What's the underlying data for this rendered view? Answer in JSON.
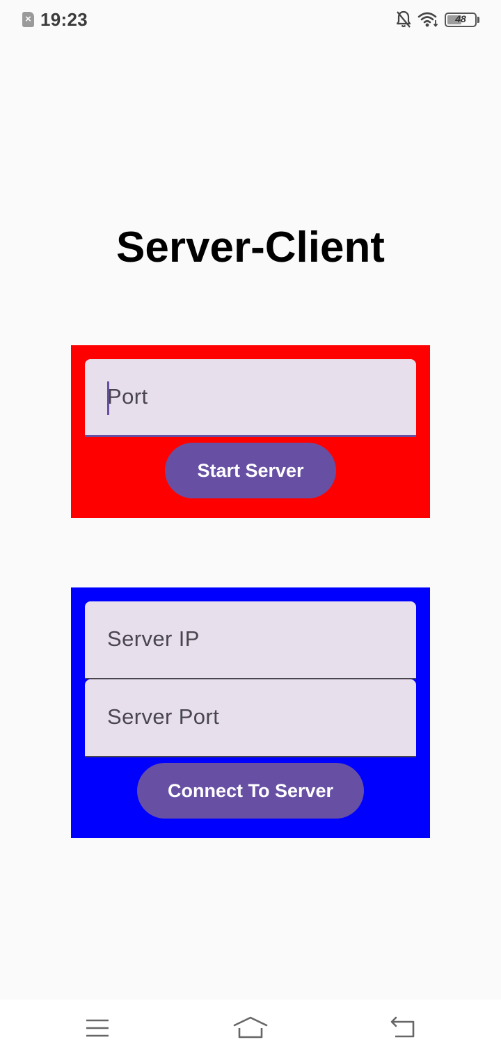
{
  "status_bar": {
    "time": "19:23",
    "battery_level": "48",
    "icons": [
      "sim-icon",
      "bell-off-icon",
      "wifi-icon",
      "battery-icon"
    ]
  },
  "title": "Server-Client",
  "server_panel": {
    "color": "#ff0000",
    "port_placeholder": "Port",
    "start_button": "Start Server"
  },
  "client_panel": {
    "color": "#0000ff",
    "ip_placeholder": "Server IP",
    "port_placeholder": "Server Port",
    "connect_button": "Connect To Server"
  },
  "nav_bar": {
    "icons": [
      "menu-icon",
      "home-icon",
      "back-icon"
    ]
  },
  "colors": {
    "accent": "#6750a4",
    "field_background": "#e7dfec",
    "background": "#fafafa"
  }
}
